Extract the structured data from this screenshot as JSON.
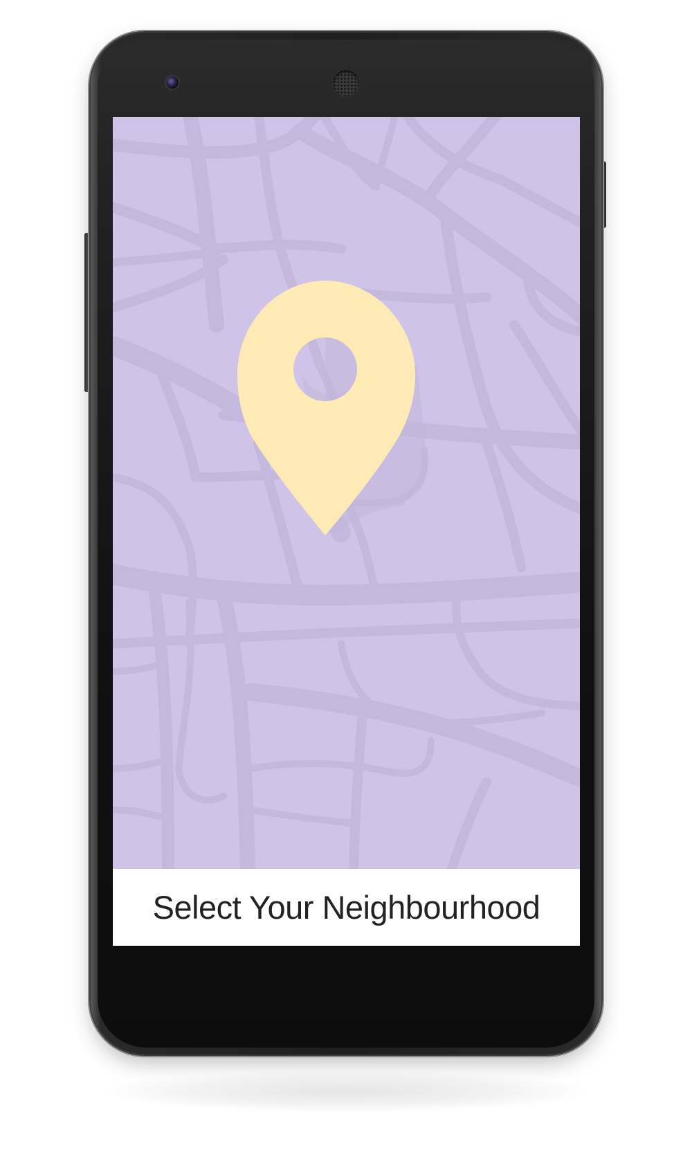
{
  "screen": {
    "title": "Select Your Neighbourhood",
    "map_background_color": "#cfc4e7",
    "map_road_color": "#c4b8dc",
    "pin_color": "#feeab5",
    "pin_icon": "map-pin-icon"
  },
  "device": {
    "type": "android-phone",
    "camera_icon": "front-camera-icon",
    "speaker_icon": "speaker-grille-icon"
  }
}
